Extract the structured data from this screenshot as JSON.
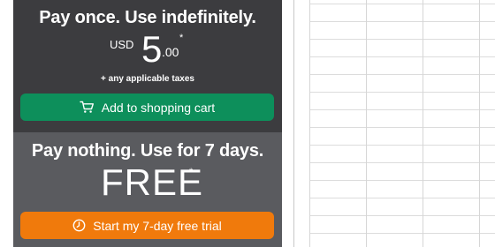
{
  "paid_offer": {
    "headline": "Pay once. Use indefinitely.",
    "currency": "USD",
    "price_integer": "5",
    "price_decimal": ".00",
    "asterisk": "*",
    "taxes_note": "+ any applicable taxes",
    "cart_button_label": "Add to shopping cart",
    "cart_icon": "shopping-cart-icon",
    "button_color": "#0d8f5b"
  },
  "free_offer": {
    "headline": "Pay nothing. Use for 7 days.",
    "free_label": "FREE",
    "asterisk": "*",
    "trial_button_label": "Start my 7-day free trial",
    "trial_icon": "clock-icon",
    "button_color": "#f07a0c"
  },
  "colors": {
    "paid_background": "#3c3c3f",
    "free_background": "#5a5b5f"
  }
}
